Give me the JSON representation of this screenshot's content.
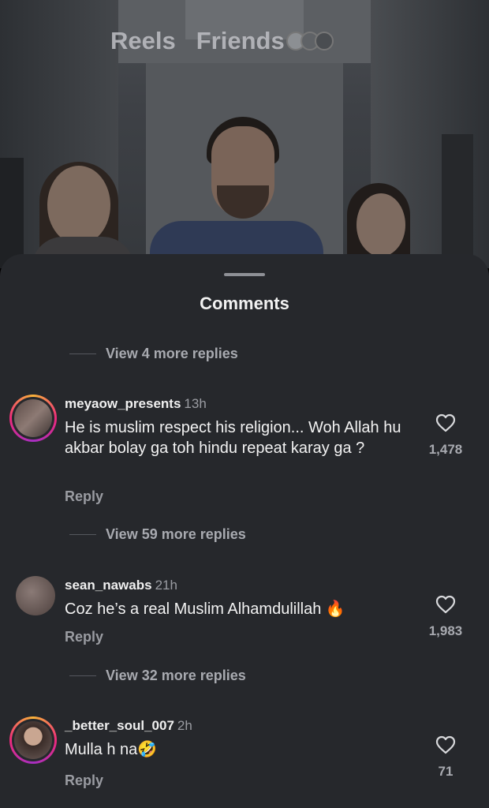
{
  "video": {
    "tabs": [
      "Reels",
      "Friends"
    ]
  },
  "sheet": {
    "title": "Comments"
  },
  "replies_links": [
    "View 4 more replies",
    "View 59 more replies",
    "View 32 more replies"
  ],
  "comments": [
    {
      "username": "meyaow_presents",
      "time": "13h",
      "text": "He is muslim respect his religion... Woh Allah hu akbar bolay ga toh hindu repeat karay ga ?",
      "reply_label": "Reply",
      "likes": "1,478",
      "has_story_ring": true
    },
    {
      "username": "sean_nawabs",
      "time": "21h",
      "text": "Coz he’s a real Muslim Alhamdulillah 🔥",
      "reply_label": "Reply",
      "likes": "1,983",
      "has_story_ring": false
    },
    {
      "username": "_better_soul_007",
      "time": "2h",
      "text": "Mulla h na🤣",
      "reply_label": "Reply",
      "likes": "71",
      "has_story_ring": true
    }
  ],
  "colors": {
    "sheet_bg": "#26282c",
    "text_primary": "#f2f2f2",
    "text_secondary": "#9a9ca2"
  },
  "icons": {
    "like": "heart-outline-icon"
  }
}
